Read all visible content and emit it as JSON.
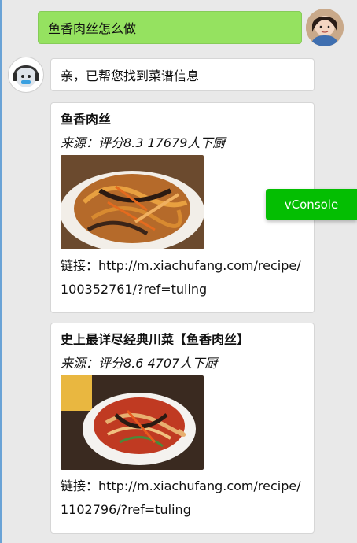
{
  "chat": {
    "user_message": "鱼香肉丝怎么做",
    "bot_reply": "亲，已帮您找到菜谱信息"
  },
  "recipes": [
    {
      "title": "鱼香肉丝",
      "source": "来源：评分8.3 17679人下厨",
      "link_label": "链接：",
      "link_url": "http://m.xiachufang.com/recipe/100352761/?ref=tuling"
    },
    {
      "title": "史上最详尽经典川菜【鱼香肉丝】",
      "source": "来源：评分8.6 4707人下厨",
      "link_label": "链接：",
      "link_url": "http://m.xiachufang.com/recipe/1102796/?ref=tuling"
    }
  ],
  "vconsole": {
    "label": "vConsole"
  },
  "colors": {
    "user_bubble": "#95e260",
    "vconsole_bg": "#04be02",
    "background": "#e9e9e9"
  }
}
